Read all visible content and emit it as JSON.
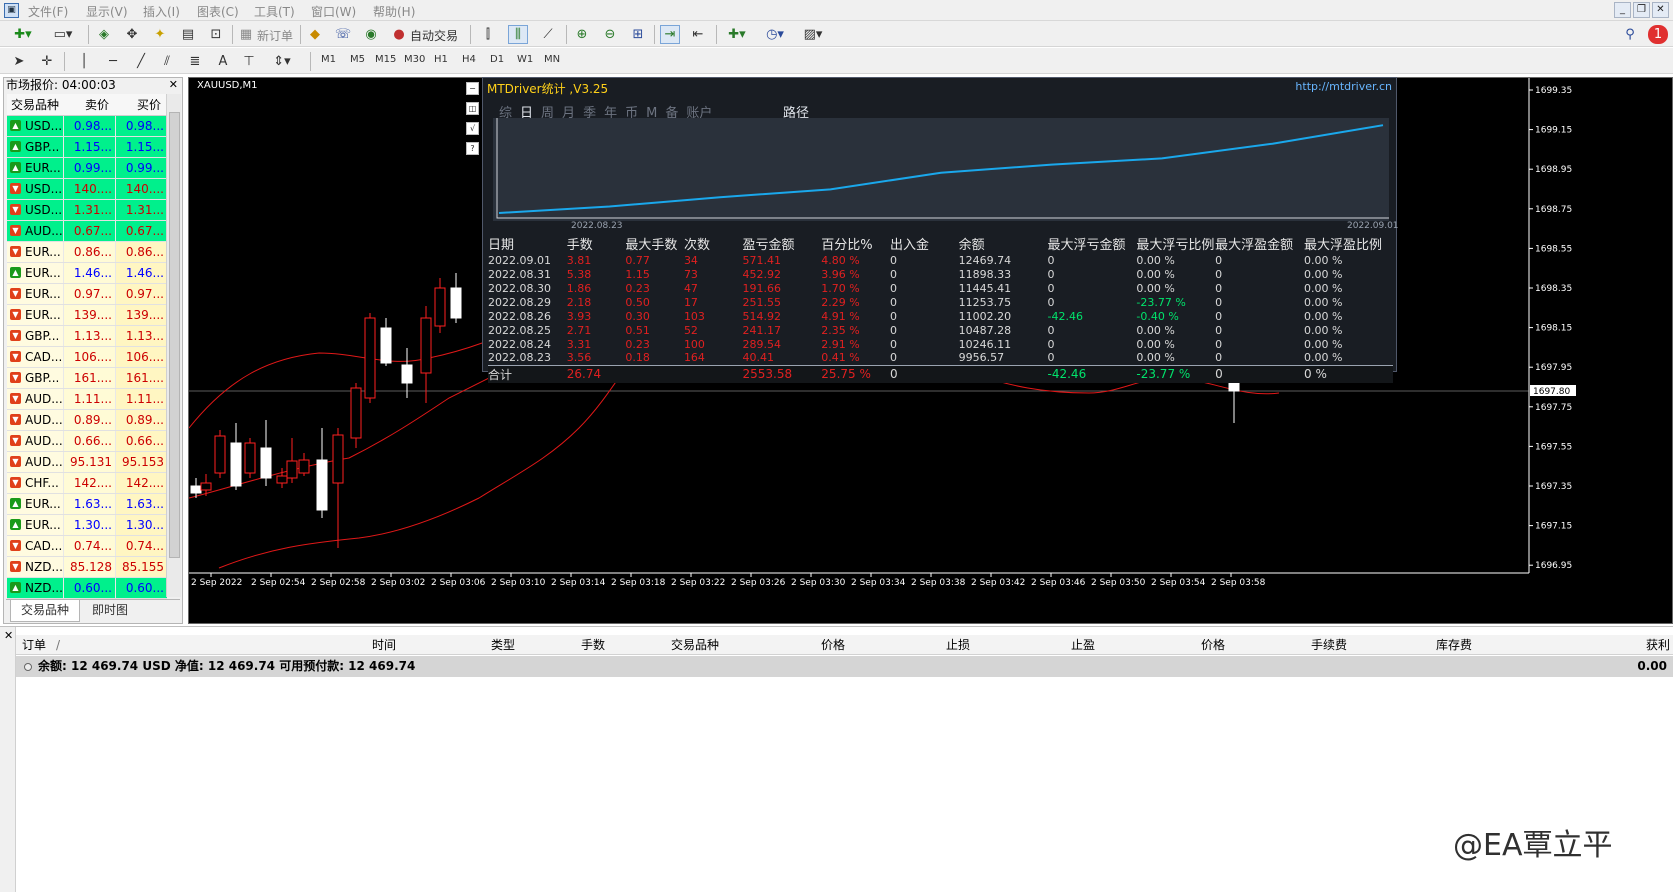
{
  "menu": {
    "items": [
      "文件(F)",
      "显示(V)",
      "插入(I)",
      "图表(C)",
      "工具(T)",
      "窗口(W)",
      "帮助(H)"
    ]
  },
  "toolbar": {
    "new_order": "新订单",
    "auto_trade": "自动交易",
    "timeframes": [
      "M1",
      "M5",
      "M15",
      "M30",
      "H1",
      "H4",
      "D1",
      "W1",
      "MN"
    ]
  },
  "market_watch": {
    "title": "市场报价: 04:00:03",
    "columns": [
      "交易品种",
      "卖价",
      "买价"
    ],
    "rows": [
      {
        "symbol": "USD...",
        "bid": "0.98...",
        "ask": "0.98...",
        "dir": "up",
        "hl": true,
        "color": "#0000ff"
      },
      {
        "symbol": "GBP...",
        "bid": "1.15...",
        "ask": "1.15...",
        "dir": "up",
        "hl": true,
        "color": "#0000ff"
      },
      {
        "symbol": "EUR...",
        "bid": "0.99...",
        "ask": "0.99...",
        "dir": "up",
        "hl": true,
        "color": "#0000ff"
      },
      {
        "symbol": "USD...",
        "bid": "140....",
        "ask": "140....",
        "dir": "down",
        "hl": true,
        "color": "#cc0000"
      },
      {
        "symbol": "USD...",
        "bid": "1.31...",
        "ask": "1.31...",
        "dir": "down",
        "hl": true,
        "color": "#cc0000"
      },
      {
        "symbol": "AUD...",
        "bid": "0.67...",
        "ask": "0.67...",
        "dir": "down",
        "hl": true,
        "color": "#cc0000"
      },
      {
        "symbol": "EUR...",
        "bid": "0.86...",
        "ask": "0.86...",
        "dir": "down",
        "hl": false,
        "color": "#cc0000"
      },
      {
        "symbol": "EUR...",
        "bid": "1.46...",
        "ask": "1.46...",
        "dir": "up",
        "hl": false,
        "color": "#0000ff"
      },
      {
        "symbol": "EUR...",
        "bid": "0.97...",
        "ask": "0.97...",
        "dir": "down",
        "hl": false,
        "color": "#cc0000"
      },
      {
        "symbol": "EUR...",
        "bid": "139....",
        "ask": "139....",
        "dir": "down",
        "hl": false,
        "color": "#cc0000"
      },
      {
        "symbol": "GBP...",
        "bid": "1.13...",
        "ask": "1.13...",
        "dir": "down",
        "hl": false,
        "color": "#cc0000"
      },
      {
        "symbol": "CAD...",
        "bid": "106....",
        "ask": "106....",
        "dir": "down",
        "hl": false,
        "color": "#cc0000"
      },
      {
        "symbol": "GBP...",
        "bid": "161....",
        "ask": "161....",
        "dir": "down",
        "hl": false,
        "color": "#cc0000"
      },
      {
        "symbol": "AUD...",
        "bid": "1.11...",
        "ask": "1.11...",
        "dir": "down",
        "hl": false,
        "color": "#cc0000"
      },
      {
        "symbol": "AUD...",
        "bid": "0.89...",
        "ask": "0.89...",
        "dir": "down",
        "hl": false,
        "color": "#cc0000"
      },
      {
        "symbol": "AUD...",
        "bid": "0.66...",
        "ask": "0.66...",
        "dir": "down",
        "hl": false,
        "color": "#cc0000"
      },
      {
        "symbol": "AUD...",
        "bid": "95.131",
        "ask": "95.153",
        "dir": "down",
        "hl": false,
        "color": "#cc0000"
      },
      {
        "symbol": "CHF...",
        "bid": "142....",
        "ask": "142....",
        "dir": "down",
        "hl": false,
        "color": "#cc0000"
      },
      {
        "symbol": "EUR...",
        "bid": "1.63...",
        "ask": "1.63...",
        "dir": "up",
        "hl": false,
        "color": "#0000ff"
      },
      {
        "symbol": "EUR...",
        "bid": "1.30...",
        "ask": "1.30...",
        "dir": "up",
        "hl": false,
        "color": "#0000ff"
      },
      {
        "symbol": "CAD...",
        "bid": "0.74...",
        "ask": "0.74...",
        "dir": "down",
        "hl": false,
        "color": "#cc0000"
      },
      {
        "symbol": "NZD...",
        "bid": "85.128",
        "ask": "85.155",
        "dir": "down",
        "hl": false,
        "color": "#cc0000"
      },
      {
        "symbol": "NZD...",
        "bid": "0.60...",
        "ask": "0.60...",
        "dir": "up",
        "hl": true,
        "color": "#0000ff"
      }
    ],
    "tabs": [
      "交易品种",
      "即时图"
    ]
  },
  "chart": {
    "symbol": "XAUUSD,M1",
    "price_labels": [
      "1699.35",
      "1699.15",
      "1698.95",
      "1698.75",
      "1698.55",
      "1698.35",
      "1698.15",
      "1697.95",
      "1697.75",
      "1697.55",
      "1697.35",
      "1697.15",
      "1696.95"
    ],
    "current_price": "1697.80",
    "time_labels": [
      "2 Sep 2022",
      "2 Sep 02:54",
      "2 Sep 02:58",
      "2 Sep 03:02",
      "2 Sep 03:06",
      "2 Sep 03:10",
      "2 Sep 03:14",
      "2 Sep 03:18",
      "2 Sep 03:22",
      "2 Sep 03:26",
      "2 Sep 03:30",
      "2 Sep 03:34",
      "2 Sep 03:38",
      "2 Sep 03:42",
      "2 Sep 03:46",
      "2 Sep 03:50",
      "2 Sep 03:54",
      "2 Sep 03:58"
    ]
  },
  "mtdriver": {
    "title": "MTDriver统计 ,V3.25",
    "link": "http://mtdriver.cn",
    "tabs": [
      "综",
      "日",
      "周",
      "月",
      "季",
      "年",
      "币",
      "M",
      "备",
      "账户"
    ],
    "active_tab": "日",
    "path_label": "路径",
    "graph_start": "2022.08.23",
    "graph_end": "2022.09.01",
    "balance_curve": [
      9956.57,
      10246.11,
      10487.28,
      11002.2,
      11253.75,
      11445.41,
      11898.33,
      12469.74
    ],
    "columns": [
      "日期",
      "手数",
      "最大手数",
      "次数",
      "盈亏金额",
      "百分比%",
      "出入金",
      "余额",
      "最大浮亏金额",
      "最大浮亏比例",
      "最大浮盈金额",
      "最大浮盈比例"
    ],
    "rows": [
      [
        "2022.09.01",
        "3.81",
        "0.77",
        "34",
        "571.41",
        "4.80 %",
        "0",
        "12469.74",
        "0",
        "0.00 %",
        "0",
        "0.00 %"
      ],
      [
        "2022.08.31",
        "5.38",
        "1.15",
        "73",
        "452.92",
        "3.96 %",
        "0",
        "11898.33",
        "0",
        "0.00 %",
        "0",
        "0.00 %"
      ],
      [
        "2022.08.30",
        "1.86",
        "0.23",
        "47",
        "191.66",
        "1.70 %",
        "0",
        "11445.41",
        "0",
        "0.00 %",
        "0",
        "0.00 %"
      ],
      [
        "2022.08.29",
        "2.18",
        "0.50",
        "17",
        "251.55",
        "2.29 %",
        "0",
        "11253.75",
        "0",
        "-23.77 %",
        "0",
        "0.00 %"
      ],
      [
        "2022.08.26",
        "3.93",
        "0.30",
        "103",
        "514.92",
        "4.91 %",
        "0",
        "11002.20",
        "-42.46",
        "-0.40 %",
        "0",
        "0.00 %"
      ],
      [
        "2022.08.25",
        "2.71",
        "0.51",
        "52",
        "241.17",
        "2.35 %",
        "0",
        "10487.28",
        "0",
        "0.00 %",
        "0",
        "0.00 %"
      ],
      [
        "2022.08.24",
        "3.31",
        "0.23",
        "100",
        "289.54",
        "2.91 %",
        "0",
        "10246.11",
        "0",
        "0.00 %",
        "0",
        "0.00 %"
      ],
      [
        "2022.08.23",
        "3.56",
        "0.18",
        "164",
        "40.41",
        "0.41 %",
        "0",
        "9956.57",
        "0",
        "0.00 %",
        "0",
        "0.00 %"
      ]
    ],
    "total": [
      "合计",
      "26.74",
      "",
      "",
      "2553.58",
      "25.75 %",
      "0",
      "",
      "-42.46",
      "-23.77 %",
      "0",
      "0 %"
    ]
  },
  "terminal": {
    "columns": [
      "订单",
      "时间",
      "类型",
      "手数",
      "交易品种",
      "价格",
      "止损",
      "止盈",
      "价格",
      "手续费",
      "库存费",
      "获利"
    ],
    "balance_line": "余额: 12 469.74 USD  净值: 12 469.74  可用预付款: 12 469.74",
    "profit": "0.00"
  },
  "watermark": "@EA覃立平",
  "colors": {
    "up": "#1a9a1a",
    "down": "#e0401a",
    "highlight": "#00f08c",
    "sell_col_bg": "#fffbd6",
    "buy_col_bg": "#fff6c2"
  }
}
